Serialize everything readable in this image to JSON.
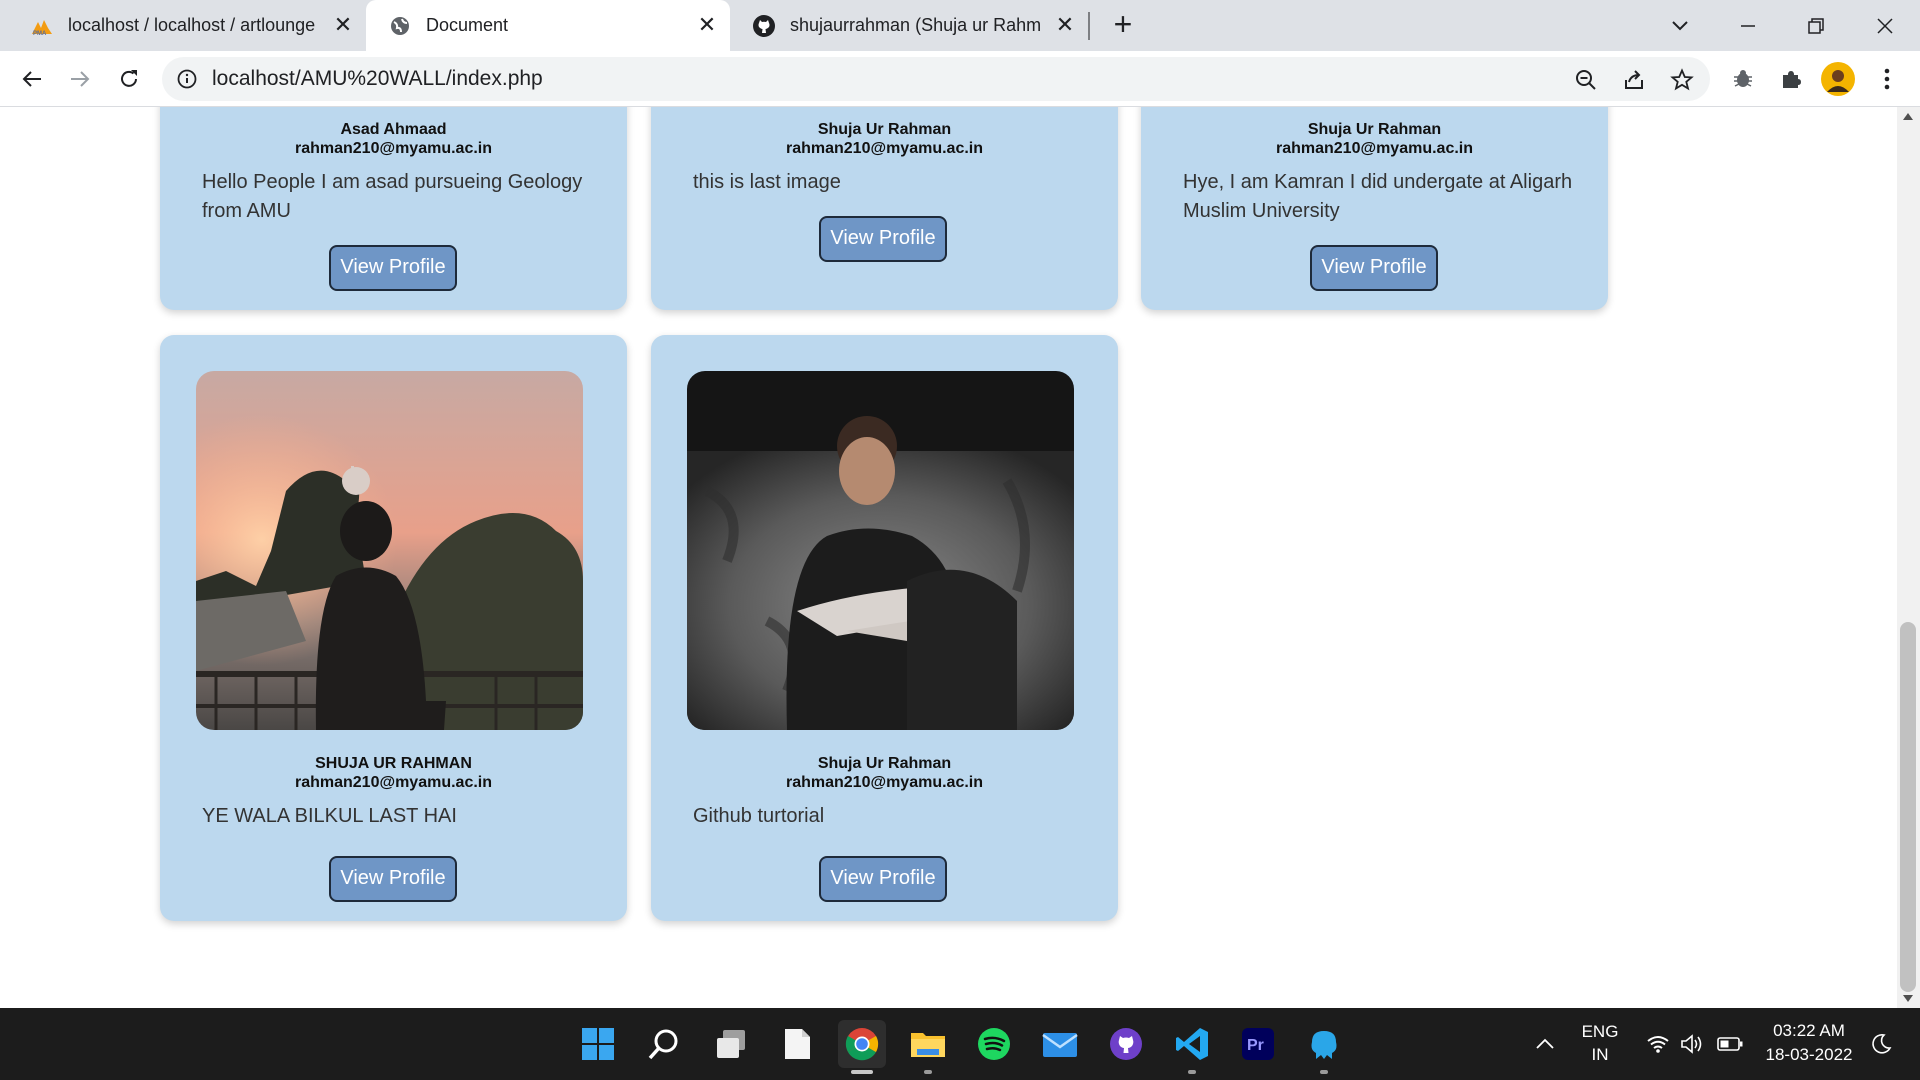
{
  "browser": {
    "tabs": [
      {
        "title": "localhost / localhost / artlounge / ",
        "icon": "phpmyadmin-icon"
      },
      {
        "title": "Document",
        "icon": "globe-icon"
      },
      {
        "title": "shujaurrahman (Shuja ur Rahman)",
        "icon": "github-icon"
      }
    ],
    "url": "localhost/AMU%20WALL/index.php"
  },
  "cards_top": [
    {
      "name": "Asad Ahmaad",
      "email": "rahman210@myamu.ac.in",
      "bio": "Hello People I am asad pursueing Geology from AMU",
      "button": "View Profile"
    },
    {
      "name": "Shuja Ur Rahman",
      "email": "rahman210@myamu.ac.in",
      "bio": "this is last image",
      "button": "View Profile"
    },
    {
      "name": "Shuja Ur Rahman",
      "email": "rahman210@myamu.ac.in",
      "bio": "Hye, I am Kamran I did undergate at Aligarh Muslim University",
      "button": "View Profile"
    }
  ],
  "cards_bottom": [
    {
      "name": "SHUJA UR RAHMAN",
      "email": "rahman210@myamu.ac.in",
      "bio": "YE WALA BILKUL LAST HAI",
      "button": "View Profile"
    },
    {
      "name": "Shuja Ur Rahman",
      "email": "rahman210@myamu.ac.in",
      "bio": "Github turtorial",
      "button": "View Profile"
    }
  ],
  "taskbar": {
    "lang_primary": "ENG",
    "lang_secondary": "IN",
    "time": "03:22 AM",
    "date": "18-03-2022"
  },
  "colors": {
    "card_background": "#bcd8ee",
    "button_background": "#6f96c6",
    "taskbar": "#1c1c1c"
  }
}
